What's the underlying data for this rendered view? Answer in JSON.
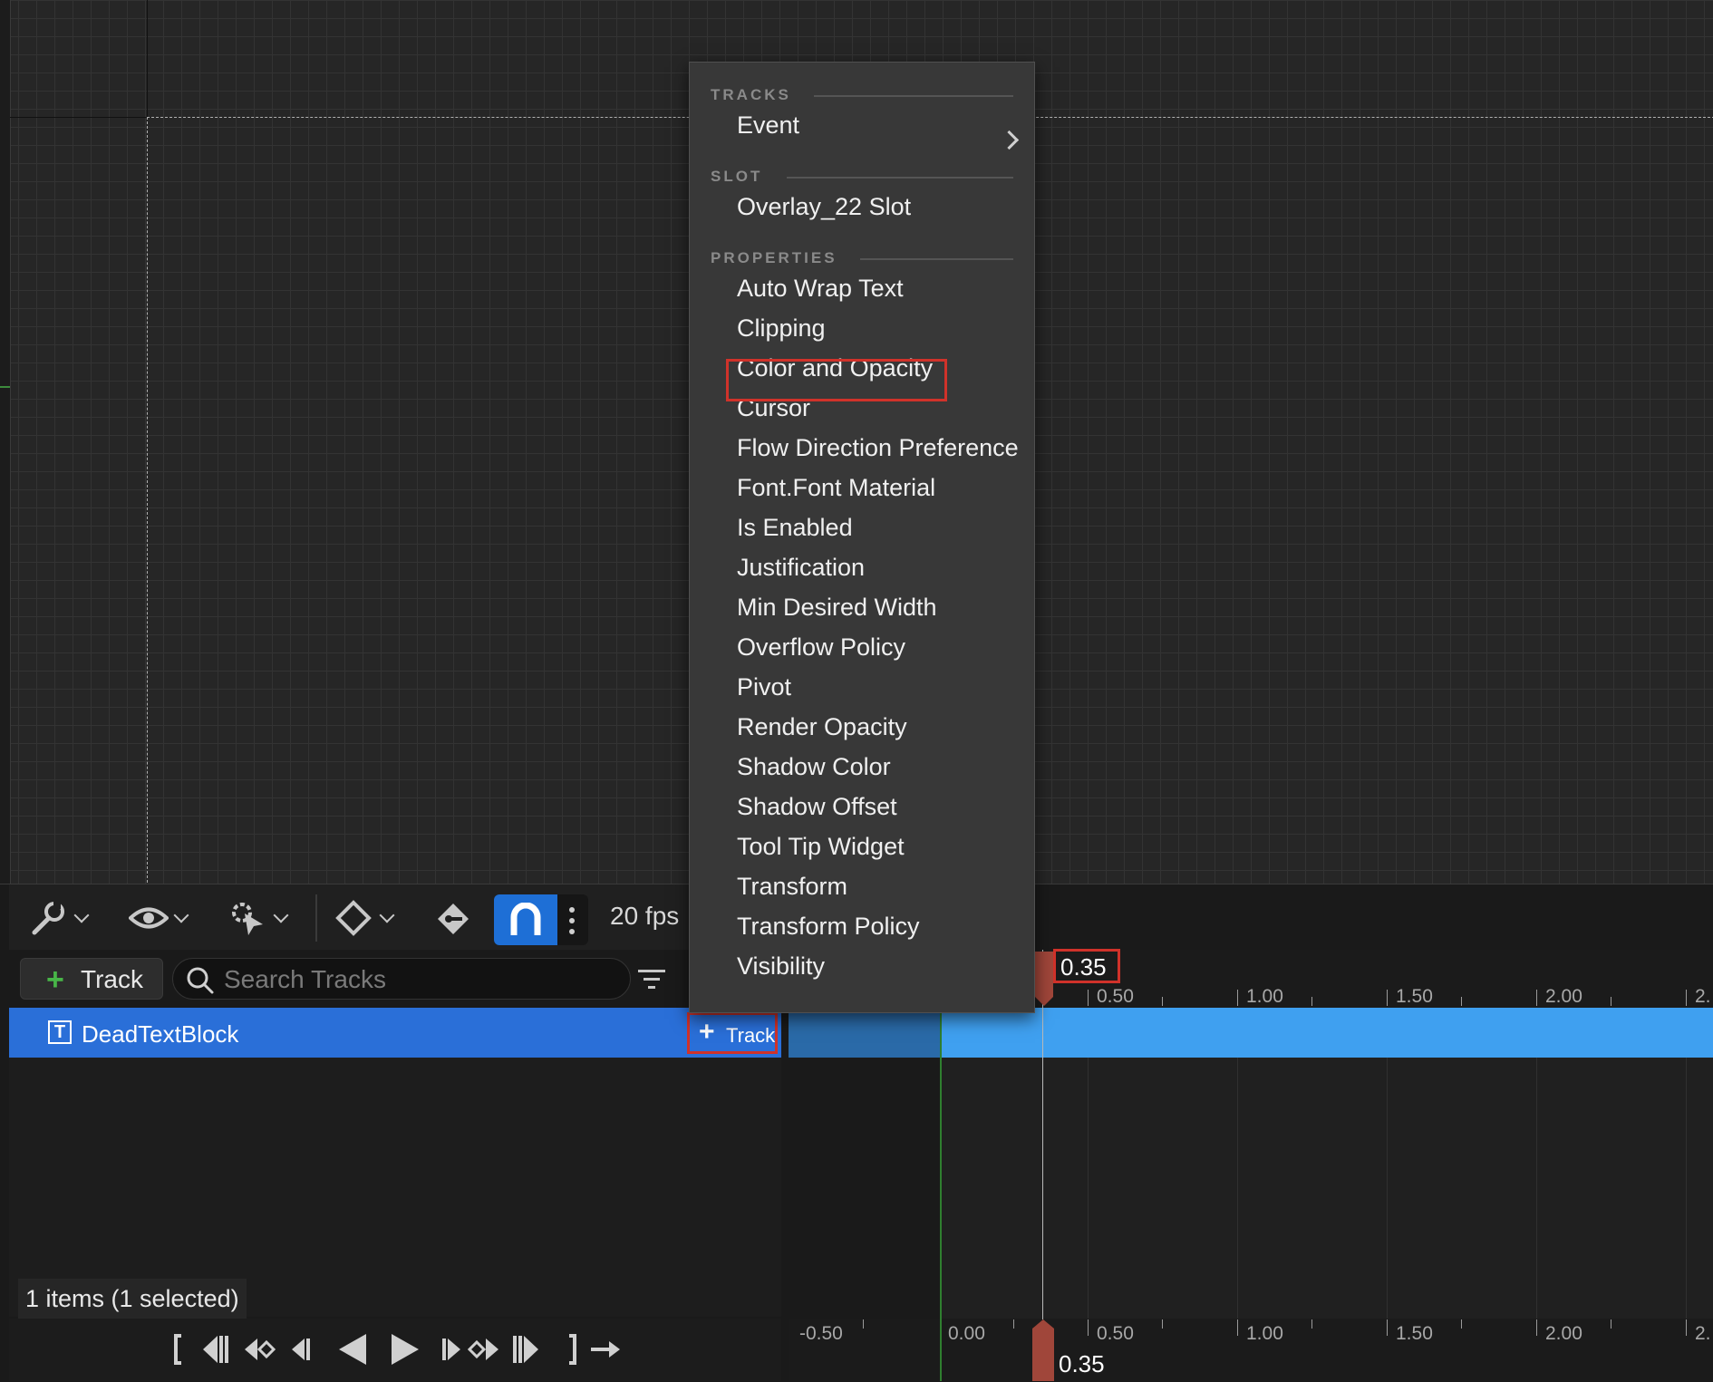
{
  "toolbar": {
    "fps": "20 fps"
  },
  "outliner": {
    "add_track_label": "Track",
    "search_placeholder": "Search Tracks",
    "row_icon": "T",
    "row_name": "DeadTextBlock",
    "row_add_track_label": "Track",
    "items_count": "1 items (1 selected)"
  },
  "timeline": {
    "playhead_time": "0.35",
    "top_ticks": [
      "0.50",
      "1.00",
      "1.50",
      "2.00",
      "2."
    ],
    "bottom_ticks": [
      "-0.50",
      "0.00",
      "0.50",
      "1.00",
      "1.50",
      "2.00",
      "2."
    ]
  },
  "menu": {
    "sections": [
      {
        "header": "TRACKS",
        "items": [
          "Event"
        ]
      },
      {
        "header": "SLOT",
        "items": [
          "Overlay_22 Slot"
        ]
      },
      {
        "header": "PROPERTIES",
        "items": [
          "Auto Wrap Text",
          "Clipping",
          "Color and Opacity",
          "Cursor",
          "Flow Direction Preference",
          "Font.Font Material",
          "Is Enabled",
          "Justification",
          "Min Desired Width",
          "Overflow Policy",
          "Pivot",
          "Render Opacity",
          "Shadow Color",
          "Shadow Offset",
          "Tool Tip Widget",
          "Transform",
          "Transform Policy",
          "Visibility"
        ]
      }
    ],
    "highlighted_item": "Color and Opacity"
  },
  "colors": {
    "selection_blue": "#2a6fd8",
    "section_blue": "#3fa0f0",
    "highlight_red": "#d0322a",
    "accent_green": "#48b548"
  }
}
